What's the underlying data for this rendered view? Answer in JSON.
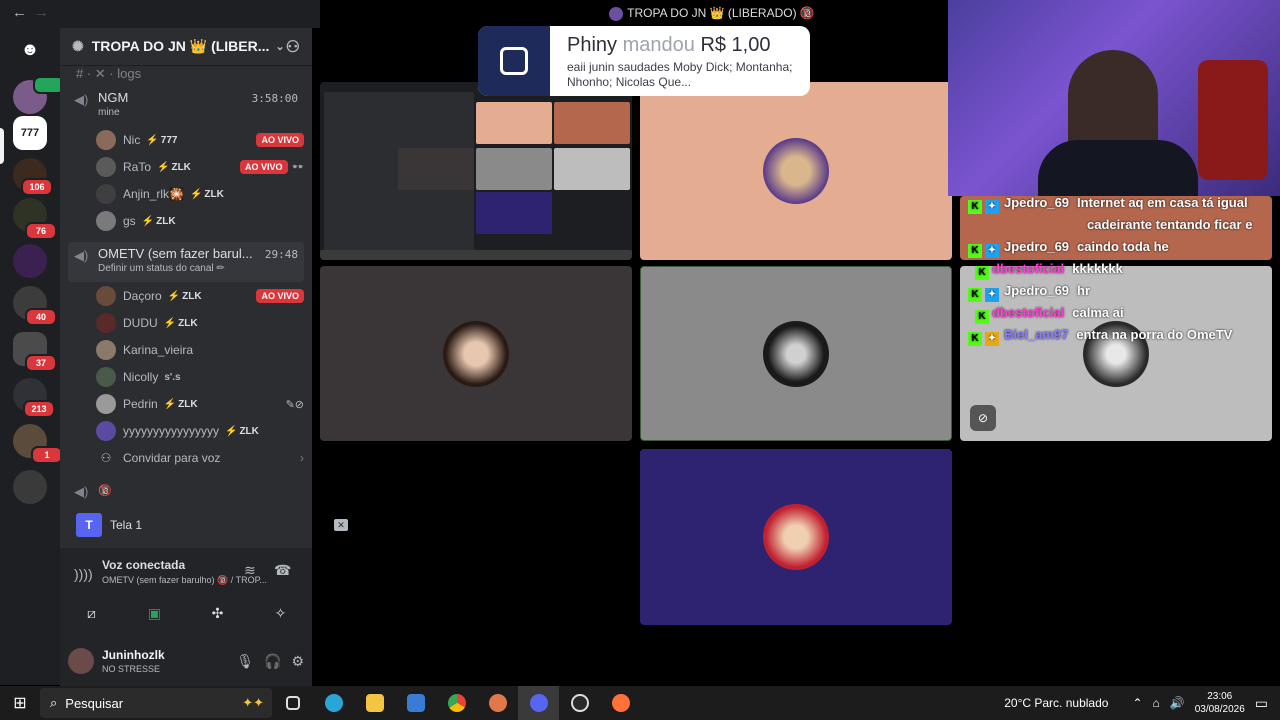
{
  "stage": {
    "title": "TROPA DO JN 👑 (LIBERADO) 🔞"
  },
  "rail": {
    "badges": [
      "106",
      "76",
      "40",
      "37",
      "213",
      "1"
    ]
  },
  "server": {
    "name": "TROPA DO JN 👑 (LIBER..."
  },
  "channels": {
    "logs_label": "logs",
    "voice1": {
      "name": "NGM",
      "timer": "3:58:00",
      "sub": "mine"
    },
    "voice2": {
      "name": "OMETV (sem fazer barul...",
      "timer": "29:48",
      "sub": "Definir um status do canal ✏"
    },
    "voice3_badge": "🔞",
    "invite_label": "Convidar para voz",
    "live_label": "AO VIVO",
    "group1": [
      {
        "name": "Nic",
        "tag": "777",
        "live": true
      },
      {
        "name": "RaTo",
        "tag": "ZLK",
        "live": true,
        "extra": "👓"
      },
      {
        "name": "Anjin_rlk🎇",
        "tag": "ZLK",
        "live": false
      },
      {
        "name": "gs",
        "tag": "ZLK",
        "live": false
      }
    ],
    "group2": [
      {
        "name": "Daçoro",
        "tag": "ZLK",
        "live": true
      },
      {
        "name": "DUDU",
        "tag": "ZLK",
        "live": false
      },
      {
        "name": "Karina_vieira",
        "tag": "",
        "live": false
      },
      {
        "name": "Nicolly",
        "tag": "s'.s",
        "live": false
      },
      {
        "name": "Pedrin",
        "tag": "ZLK",
        "live": false
      },
      {
        "name": "yyyyyyyyyyyyyyyy",
        "tag": "ZLK",
        "live": false
      }
    ]
  },
  "voice_panel": {
    "screen_label": "Tela 1",
    "status": "Voz conectada",
    "channel": "OMETV (sem fazer barulho) 🔞 / TROP..."
  },
  "user": {
    "name": "Juninhozlk",
    "status": "NO STRESSE"
  },
  "notification": {
    "name": "Phiny",
    "verb": "mandou",
    "amount": "R$ 1,00",
    "message": "eaii junin saudades Moby Dick; Montanha; Nhonho; Nicolas Que..."
  },
  "chat": [
    {
      "user": "Jpedro_69",
      "text": "Internet aq em casa tá igual",
      "color": "#ffffff",
      "badge": "blue"
    },
    {
      "user": "",
      "text": "cadeirante tentando ficar e",
      "color": "#ffffff",
      "badge": ""
    },
    {
      "user": "Jpedro_69",
      "text": "caindo toda he",
      "color": "#ffffff",
      "badge": "blue"
    },
    {
      "user": "dbestoficial",
      "text": "kkkkkkk",
      "color": "#ff3fd7",
      "badge": ""
    },
    {
      "user": "Jpedro_69",
      "text": "hr",
      "color": "#ffffff",
      "badge": "blue"
    },
    {
      "user": "dbestoficial",
      "text": "calma ai",
      "color": "#ff3fd7",
      "badge": ""
    },
    {
      "user": "Biel_am97",
      "text": "entra na porra do OmeTV",
      "color": "#8a7dff",
      "badge": "yellow"
    }
  ],
  "taskbar": {
    "search_placeholder": "Pesquisar",
    "weather": "20°C  Parc. nublado",
    "time": "23:06",
    "date": "03/08/2026"
  }
}
